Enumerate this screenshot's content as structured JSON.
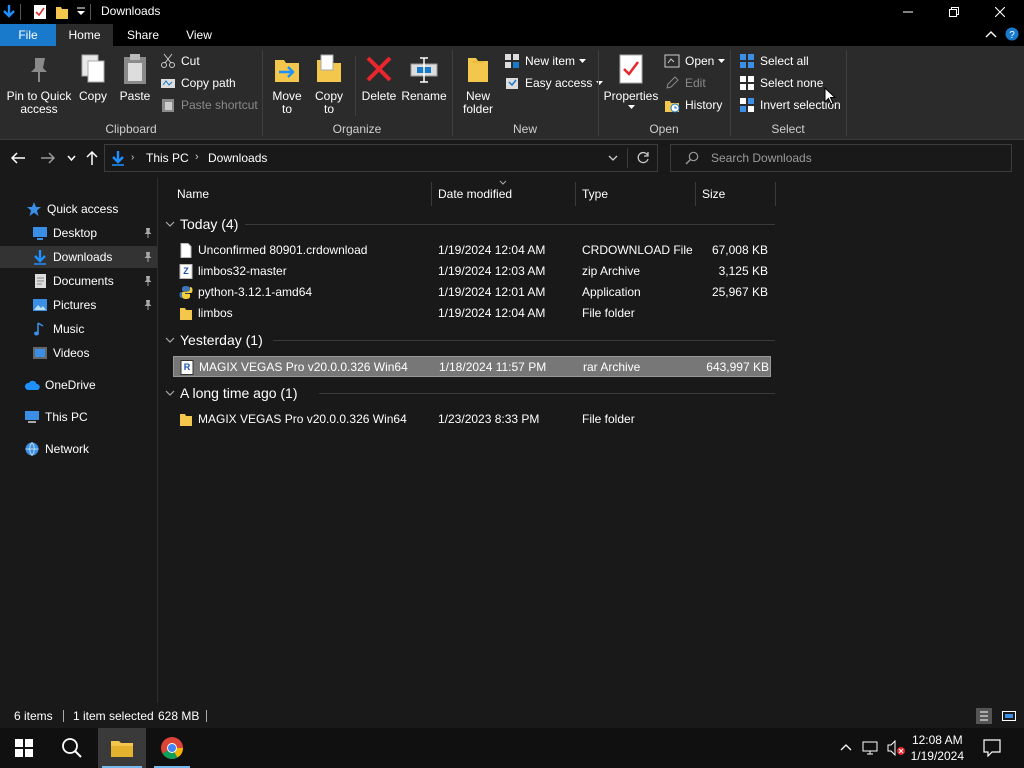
{
  "window": {
    "title": "Downloads"
  },
  "ribbon_tabs": [
    {
      "label": "File"
    },
    {
      "label": "Home"
    },
    {
      "label": "Share"
    },
    {
      "label": "View"
    }
  ],
  "ribbon": {
    "clipboard": {
      "pin_label": "Pin to Quick\naccess",
      "copy_label": "Copy",
      "paste_label": "Paste",
      "cut_label": "Cut",
      "copy_path_label": "Copy path",
      "paste_shortcut_label": "Paste shortcut",
      "group_label": "Clipboard"
    },
    "organize": {
      "move_to_label": "Move\nto",
      "copy_to_label": "Copy\nto",
      "delete_label": "Delete",
      "rename_label": "Rename",
      "group_label": "Organize"
    },
    "new": {
      "new_folder_label": "New\nfolder",
      "new_item_label": "New item",
      "easy_access_label": "Easy access",
      "group_label": "New"
    },
    "open": {
      "properties_label": "Properties",
      "open_label": "Open",
      "edit_label": "Edit",
      "history_label": "History",
      "group_label": "Open"
    },
    "select": {
      "select_all_label": "Select all",
      "select_none_label": "Select none",
      "invert_selection_label": "Invert selection",
      "group_label": "Select"
    }
  },
  "address": {
    "breadcrumb": [
      "This PC",
      "Downloads"
    ],
    "search_placeholder": "Search Downloads"
  },
  "nav": {
    "items": [
      {
        "label": "Quick access",
        "icon": "star-icon"
      },
      {
        "label": "Desktop",
        "icon": "desktop-icon",
        "pinned": true
      },
      {
        "label": "Downloads",
        "icon": "download-icon",
        "pinned": true,
        "selected": true
      },
      {
        "label": "Documents",
        "icon": "documents-icon",
        "pinned": true
      },
      {
        "label": "Pictures",
        "icon": "pictures-icon",
        "pinned": true
      },
      {
        "label": "Music",
        "icon": "music-icon"
      },
      {
        "label": "Videos",
        "icon": "videos-icon"
      },
      {
        "label": "OneDrive",
        "icon": "cloud-icon"
      },
      {
        "label": "This PC",
        "icon": "computer-icon"
      },
      {
        "label": "Network",
        "icon": "network-icon"
      }
    ]
  },
  "columns": {
    "name": "Name",
    "date": "Date modified",
    "type": "Type",
    "size": "Size"
  },
  "groups": [
    {
      "label": "Today (4)",
      "rows": [
        {
          "name": "Unconfirmed 80901.crdownload",
          "date": "1/19/2024 12:04 AM",
          "type": "CRDOWNLOAD File",
          "size": "67,008 KB",
          "icon": "file-icon"
        },
        {
          "name": "limbos32-master",
          "date": "1/19/2024 12:03 AM",
          "type": "zip Archive",
          "size": "3,125 KB",
          "icon": "zip-icon"
        },
        {
          "name": "python-3.12.1-amd64",
          "date": "1/19/2024 12:01 AM",
          "type": "Application",
          "size": "25,967 KB",
          "icon": "python-icon"
        },
        {
          "name": "limbos",
          "date": "1/19/2024 12:04 AM",
          "type": "File folder",
          "size": "",
          "icon": "folder-icon"
        }
      ]
    },
    {
      "label": "Yesterday (1)",
      "rows": [
        {
          "name": "MAGIX VEGAS Pro v20.0.0.326 Win64",
          "date": "1/18/2024 11:57 PM",
          "type": "rar Archive",
          "size": "643,997 KB",
          "icon": "rar-icon",
          "selected": true
        }
      ]
    },
    {
      "label": "A long time ago (1)",
      "rows": [
        {
          "name": "MAGIX VEGAS Pro v20.0.0.326 Win64",
          "date": "1/23/2023 8:33 PM",
          "type": "File folder",
          "size": "",
          "icon": "folder-icon"
        }
      ]
    }
  ],
  "status": {
    "items_count": "6 items",
    "selected": "1 item selected",
    "selected_size": "628 MB"
  },
  "taskbar": {
    "time": "12:08 AM",
    "date": "1/19/2024"
  },
  "colors": {
    "accent": "#1979ca",
    "background": "#191919",
    "ribbon": "#2b2b2b",
    "selection": "#777777"
  }
}
